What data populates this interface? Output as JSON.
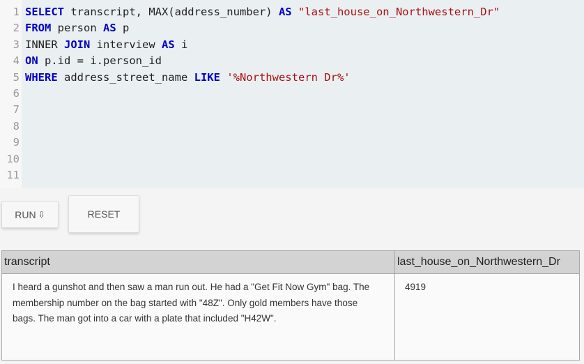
{
  "editor": {
    "lines": [
      {
        "num": "1",
        "tokens": [
          {
            "t": "SELECT",
            "k": "kw"
          },
          {
            "t": " transcript, MAX(address_number) ",
            "k": ""
          },
          {
            "t": "AS",
            "k": "kw"
          },
          {
            "t": " ",
            "k": ""
          },
          {
            "t": "\"last_house_on_Northwestern_Dr\"",
            "k": "str"
          }
        ]
      },
      {
        "num": "2",
        "tokens": [
          {
            "t": "FROM",
            "k": "kw"
          },
          {
            "t": " person ",
            "k": ""
          },
          {
            "t": "AS",
            "k": "kw"
          },
          {
            "t": " p",
            "k": ""
          }
        ]
      },
      {
        "num": "3",
        "tokens": [
          {
            "t": "INNER ",
            "k": ""
          },
          {
            "t": "JOIN",
            "k": "kw"
          },
          {
            "t": " interview ",
            "k": ""
          },
          {
            "t": "AS",
            "k": "kw"
          },
          {
            "t": " i",
            "k": ""
          }
        ]
      },
      {
        "num": "4",
        "tokens": [
          {
            "t": "ON",
            "k": "kw"
          },
          {
            "t": " p.id = i.person_id",
            "k": ""
          }
        ]
      },
      {
        "num": "5",
        "tokens": [
          {
            "t": "WHERE",
            "k": "kw"
          },
          {
            "t": " address_street_name ",
            "k": ""
          },
          {
            "t": "LIKE",
            "k": "kw"
          },
          {
            "t": " ",
            "k": ""
          },
          {
            "t": "'%Northwestern Dr%'",
            "k": "str"
          }
        ]
      },
      {
        "num": "6",
        "tokens": []
      },
      {
        "num": "7",
        "tokens": []
      },
      {
        "num": "8",
        "tokens": []
      },
      {
        "num": "9",
        "tokens": []
      },
      {
        "num": "10",
        "tokens": []
      },
      {
        "num": "11",
        "tokens": []
      }
    ]
  },
  "buttons": {
    "run_label": "RUN",
    "run_icon": "⇩",
    "reset_label": "RESET"
  },
  "results": {
    "columns": [
      "transcript",
      "last_house_on_Northwestern_Dr"
    ],
    "rows": [
      {
        "transcript": "I heard a gunshot and then saw a man run out. He had a \"Get Fit Now Gym\" bag. The membership number on the bag started with \"48Z\". Only gold members have those bags. The man got into a car with a plate that included \"H42W\".",
        "last_house_on_Northwestern_Dr": "4919"
      }
    ]
  },
  "colors": {
    "keyword": "#0000c8",
    "string": "#a11111",
    "editor_bg": "#eaeff2",
    "header_bg": "#d3d3d3"
  }
}
